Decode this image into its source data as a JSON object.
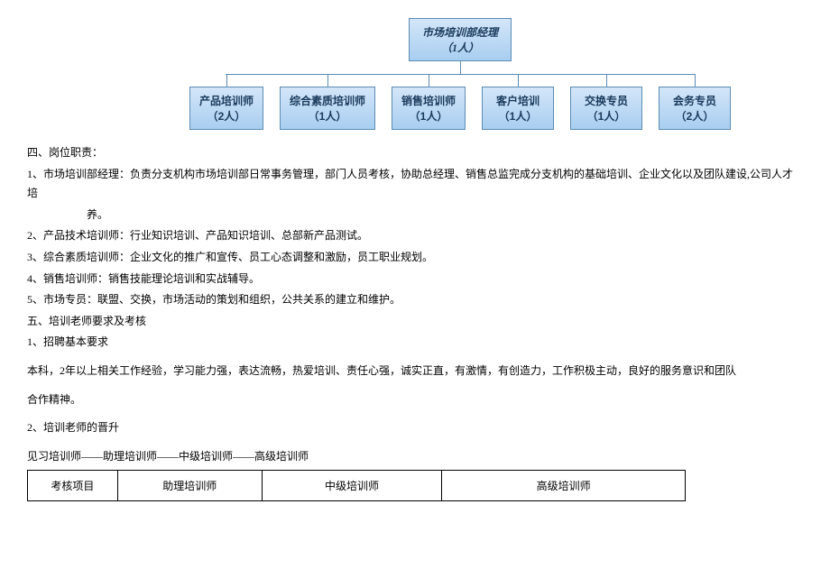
{
  "org": {
    "top": {
      "title": "市场培训部经理",
      "count": "（1人）"
    },
    "children": [
      {
        "title": "产品培训师",
        "count": "（2人）"
      },
      {
        "title": "综合素质培训师",
        "count": "（1人）"
      },
      {
        "title": "销售培训师",
        "count": "（1人）"
      },
      {
        "title": "客户培训",
        "count": "（1人）"
      },
      {
        "title": "交换专员",
        "count": "（1人）"
      },
      {
        "title": "会务专员",
        "count": "（2人）"
      }
    ]
  },
  "section4_title": "四、岗位职责：",
  "duties": [
    {
      "num": "1、",
      "role": "市场培训部经理：",
      "desc": "负责分支机构市场培训部日常事务管理，部门人员考核，协助总经理、销售总监完成分支机构的基础培训、企业文化以及团队建设,公司人才培",
      "desc2": "养。"
    },
    {
      "num": "2、",
      "role": "产品技术培训师：",
      "desc": "行业知识培训、产品知识培训、总部新产品测试。"
    },
    {
      "num": "3、",
      "role": "综合素质培训师：",
      "desc": "企业文化的推广和宣传、员工心态调整和激励，员工职业规划。"
    },
    {
      "num": "4、",
      "role": "销售培训师：",
      "desc": "销售技能理论培训和实战辅导。"
    },
    {
      "num": "5、",
      "role": "市场专员：",
      "desc": "联盟、交换，市场活动的策划和组织，公共关系的建立和维护。"
    }
  ],
  "section5_title": "五、培训老师要求及考核",
  "sub1_title": "1、招聘基本要求",
  "requirement": "本科，2年以上相关工作经验，学习能力强，表达流畅，热爱培训、责任心强，诚实正直，有激情，有创造力，工作积极主动，良好的服务意识和团队",
  "requirement2": "合作精神。",
  "sub2_title": "2、培训老师的晋升",
  "promotion_path": "见习培训师――助理培训师――中级培训师――高级培训师",
  "table": {
    "headers": [
      "考核项目",
      "助理培训师",
      "中级培训师",
      "高级培训师"
    ]
  }
}
